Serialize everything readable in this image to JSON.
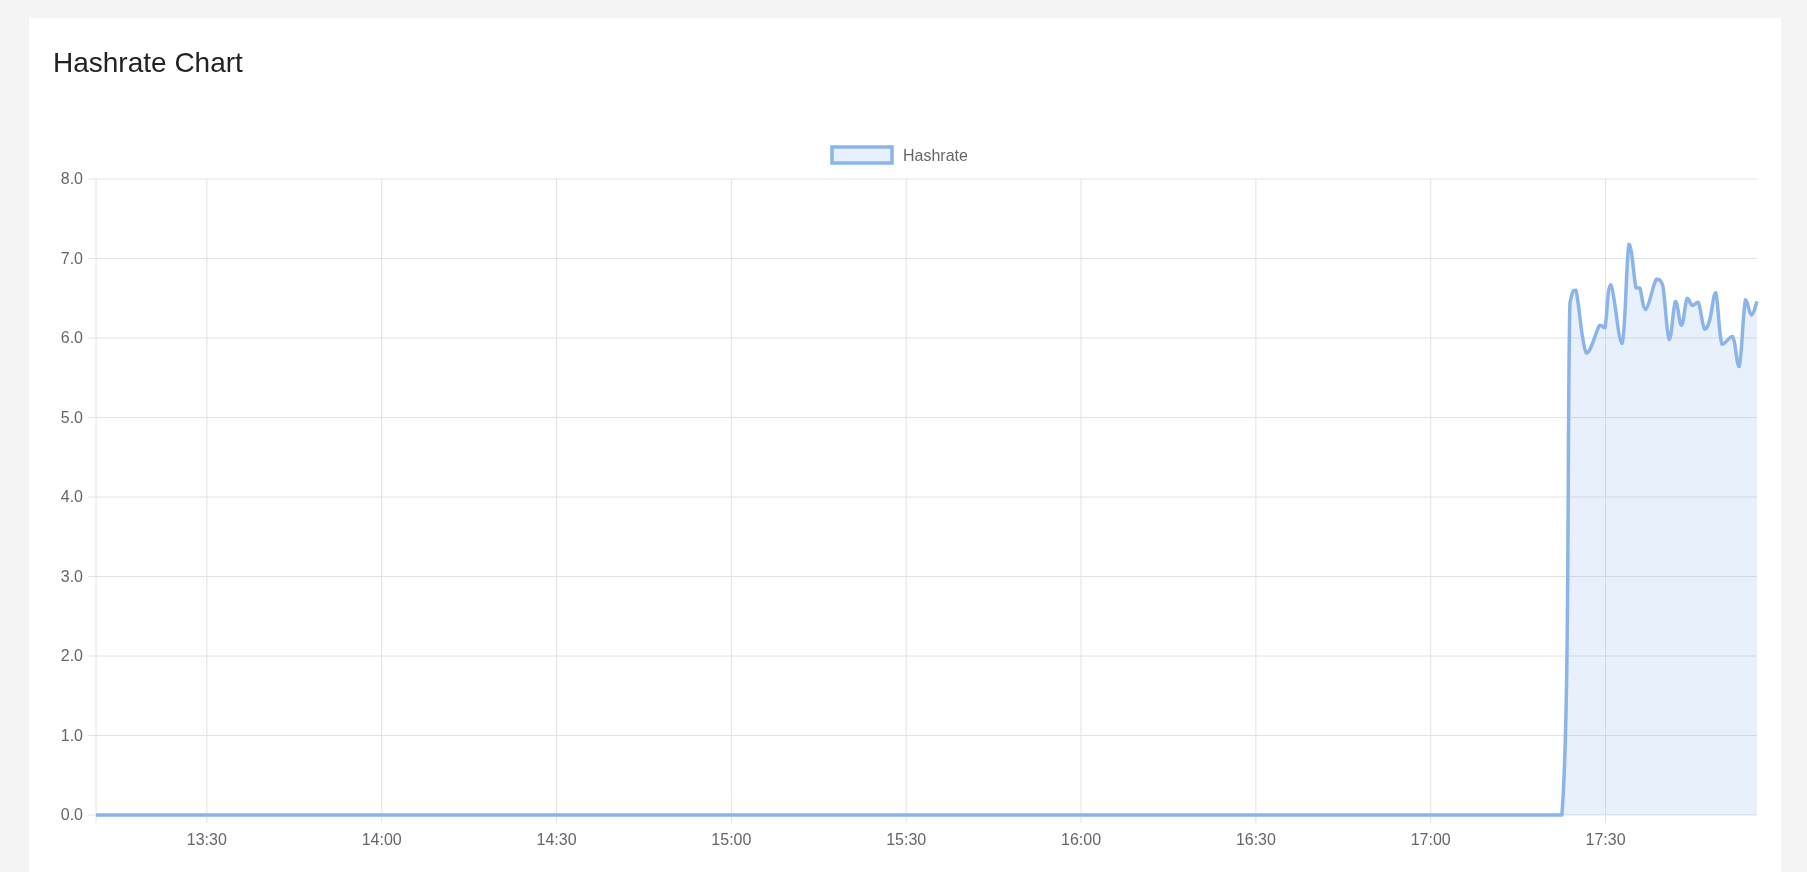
{
  "card": {
    "title": "Hashrate Chart",
    "chart_data": {
      "type": "area",
      "grid": true,
      "xlim": [
        13.183,
        17.933
      ],
      "ylim": [
        0,
        8
      ],
      "xticks": [
        {
          "value": 13.5,
          "label": "13:30"
        },
        {
          "value": 14,
          "label": "14:00"
        },
        {
          "value": 14.5,
          "label": "14:30"
        },
        {
          "value": 15,
          "label": "15:00"
        },
        {
          "value": 15.5,
          "label": "15:30"
        },
        {
          "value": 16,
          "label": "16:00"
        },
        {
          "value": 16.5,
          "label": "16:30"
        },
        {
          "value": 17,
          "label": "17:00"
        },
        {
          "value": 17.5,
          "label": "17:30"
        }
      ],
      "yticks": [
        {
          "value": 0,
          "label": "0.0"
        },
        {
          "value": 1,
          "label": "1.0"
        },
        {
          "value": 2,
          "label": "2.0"
        },
        {
          "value": 3,
          "label": "3.0"
        },
        {
          "value": 4,
          "label": "4.0"
        },
        {
          "value": 5,
          "label": "5.0"
        },
        {
          "value": 6,
          "label": "6.0"
        },
        {
          "value": 7,
          "label": "7.0"
        },
        {
          "value": 8,
          "label": "8.0"
        }
      ],
      "x": [
        13.183,
        14,
        15,
        16,
        17,
        17.375,
        17.398,
        17.415,
        17.445,
        17.483,
        17.498,
        17.515,
        17.547,
        17.567,
        17.587,
        17.598,
        17.615,
        17.645,
        17.663,
        17.682,
        17.7,
        17.717,
        17.733,
        17.748,
        17.765,
        17.783,
        17.798,
        17.815,
        17.833,
        17.863,
        17.882,
        17.9,
        17.917,
        17.933
      ],
      "series": [
        {
          "name": "Hashrate",
          "color": "#8ab4ea",
          "values": [
            0,
            0,
            0,
            0,
            0,
            0,
            6.44,
            6.6,
            5.81,
            6.16,
            6.13,
            6.67,
            5.93,
            7.18,
            6.63,
            6.63,
            6.36,
            6.74,
            6.67,
            5.98,
            6.46,
            6.16,
            6.5,
            6.41,
            6.45,
            6.11,
            6.23,
            6.57,
            5.92,
            6.02,
            5.64,
            6.48,
            6.29,
            6.46
          ]
        }
      ]
    }
  }
}
